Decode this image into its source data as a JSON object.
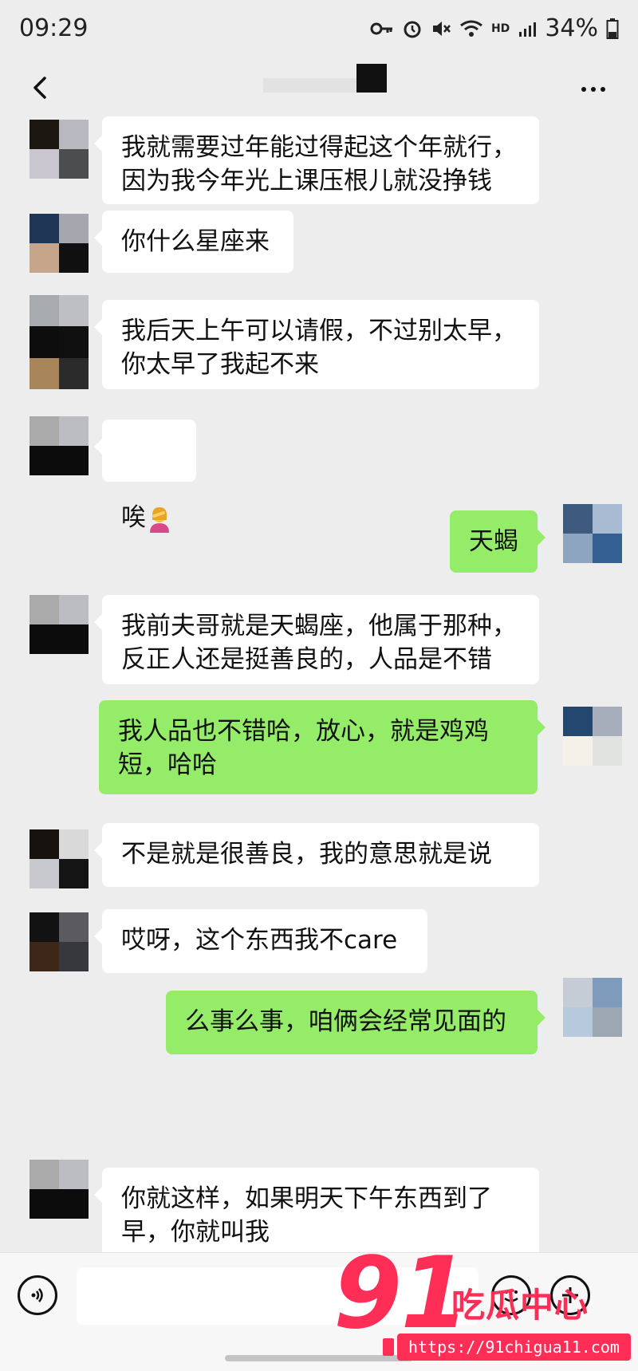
{
  "status_bar": {
    "time": "09:29",
    "battery": "34%",
    "network": "HD",
    "icons": [
      "key-icon",
      "alarm-icon",
      "mute-icon",
      "wifi-icon",
      "signal-icon",
      "battery-icon"
    ]
  },
  "nav": {
    "title": "",
    "back_icon": "chevron-left-icon",
    "more_icon": "more-dots-icon"
  },
  "messages": [
    {
      "side": "left",
      "text": "我就需要过年能过得起这个年就行，\n因为我今年光上课压根儿就没挣钱",
      "avatar_colors": [
        "#1c1710",
        "#b7b8c0",
        "#c9c6cf",
        "#4b4d4e"
      ]
    },
    {
      "side": "left",
      "text": "你什么星座来",
      "avatar_colors": [
        "#1e3556",
        "#a6a6ae",
        "#c6a58a",
        "#101010"
      ]
    },
    {
      "side": "left",
      "text": "我后天上午可以请假，不过别太早，\n你太早了我起不来",
      "avatar_colors": [
        "#0d0d0d",
        "#101010",
        "#a9855c",
        "#2b2b2b"
      ]
    },
    {
      "side": "left",
      "text": "唉",
      "has_emoji": true,
      "emoji": "woman-facepalming-icon",
      "avatar_colors": [
        "#aaaaaa",
        "#bcbcc3",
        "#0c0c0c",
        "#0c0c0c"
      ]
    },
    {
      "side": "right",
      "text": "天蝎",
      "avatar_colors": [
        "#3f5a7f",
        "#a9bbd2",
        "#8ea5c1",
        "#356093"
      ]
    },
    {
      "side": "left",
      "text": "我前夫哥就是天蝎座，他属于那种，\n反正人还是挺善良的，人品是不错",
      "avatar_colors": [
        "#aaaaaa",
        "#bcbcc3",
        "#0c0c0c",
        "#0c0c0c"
      ]
    },
    {
      "side": "right",
      "text": "我人品也不错哈，放心，就是鸡鸡\n短，哈哈",
      "avatar_colors": [
        "#244770",
        "#a6aebb",
        "#f4f1e9",
        "#e0e2df"
      ]
    },
    {
      "side": "left",
      "text": "不是就是很善良，我的意思就是说",
      "avatar_colors": [
        "#17120d",
        "#d9d9d9",
        "#c8c8cf",
        "#141414"
      ]
    },
    {
      "side": "left",
      "text": "哎呀，这个东西我不care",
      "avatar_colors": [
        "#121212",
        "#5b5b5f",
        "#3c2718",
        "#36383c"
      ]
    },
    {
      "side": "right",
      "text": "么事么事，咱俩会经常见面的",
      "avatar_colors": [
        "#c5ccd6",
        "#7e9bbb",
        "#b7c9dc",
        "#9ca7b2"
      ]
    },
    {
      "side": "left",
      "text": "你就这样，如果明天下午东西到了\n早，你就叫我",
      "avatar_colors": [
        "#aaaaaa",
        "#bcbcc3",
        "#0c0c0c",
        "#0c0c0c"
      ]
    }
  ],
  "input_bar": {
    "placeholder": "",
    "voice_icon": "voice-icon",
    "emoji_icon": "emoji-icon",
    "add_icon": "plus-icon"
  },
  "watermark": {
    "number": "91",
    "brand": "吃瓜中心",
    "url": "https://91chigua11.com"
  }
}
